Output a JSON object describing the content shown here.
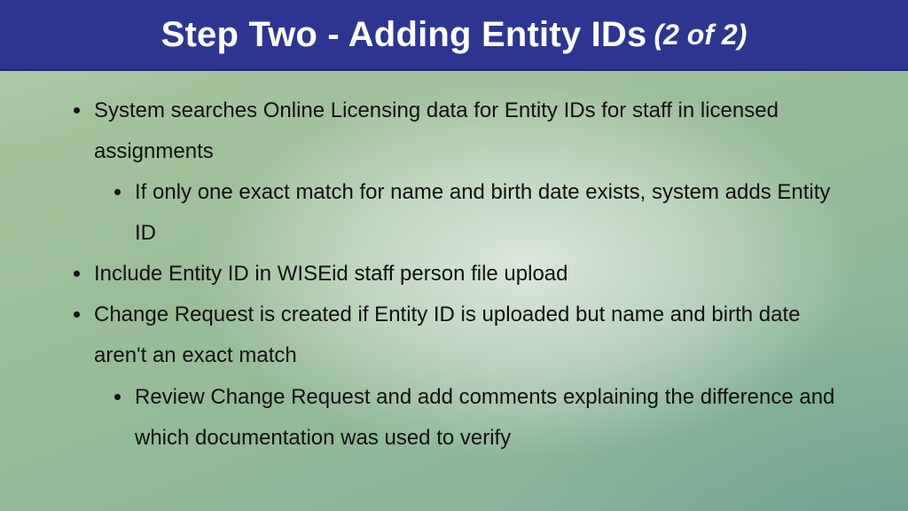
{
  "header": {
    "title_main": "Step Two - Adding Entity IDs",
    "title_sub": "(2 of 2)"
  },
  "bullets": {
    "b1": "System searches Online Licensing data for Entity IDs for staff in licensed assignments",
    "b1_1": "If only one exact match for name and birth date exists, system adds Entity ID",
    "b2": "Include Entity ID in WISEid staff person file upload",
    "b3": "Change Request is created if Entity ID is uploaded but name and birth date aren't an exact match",
    "b3_1": "Review Change Request and add comments explaining the difference and which documentation was used to verify"
  },
  "colors": {
    "header_bg": "#2c3691",
    "header_text": "#ffffff",
    "body_text": "#111111"
  }
}
